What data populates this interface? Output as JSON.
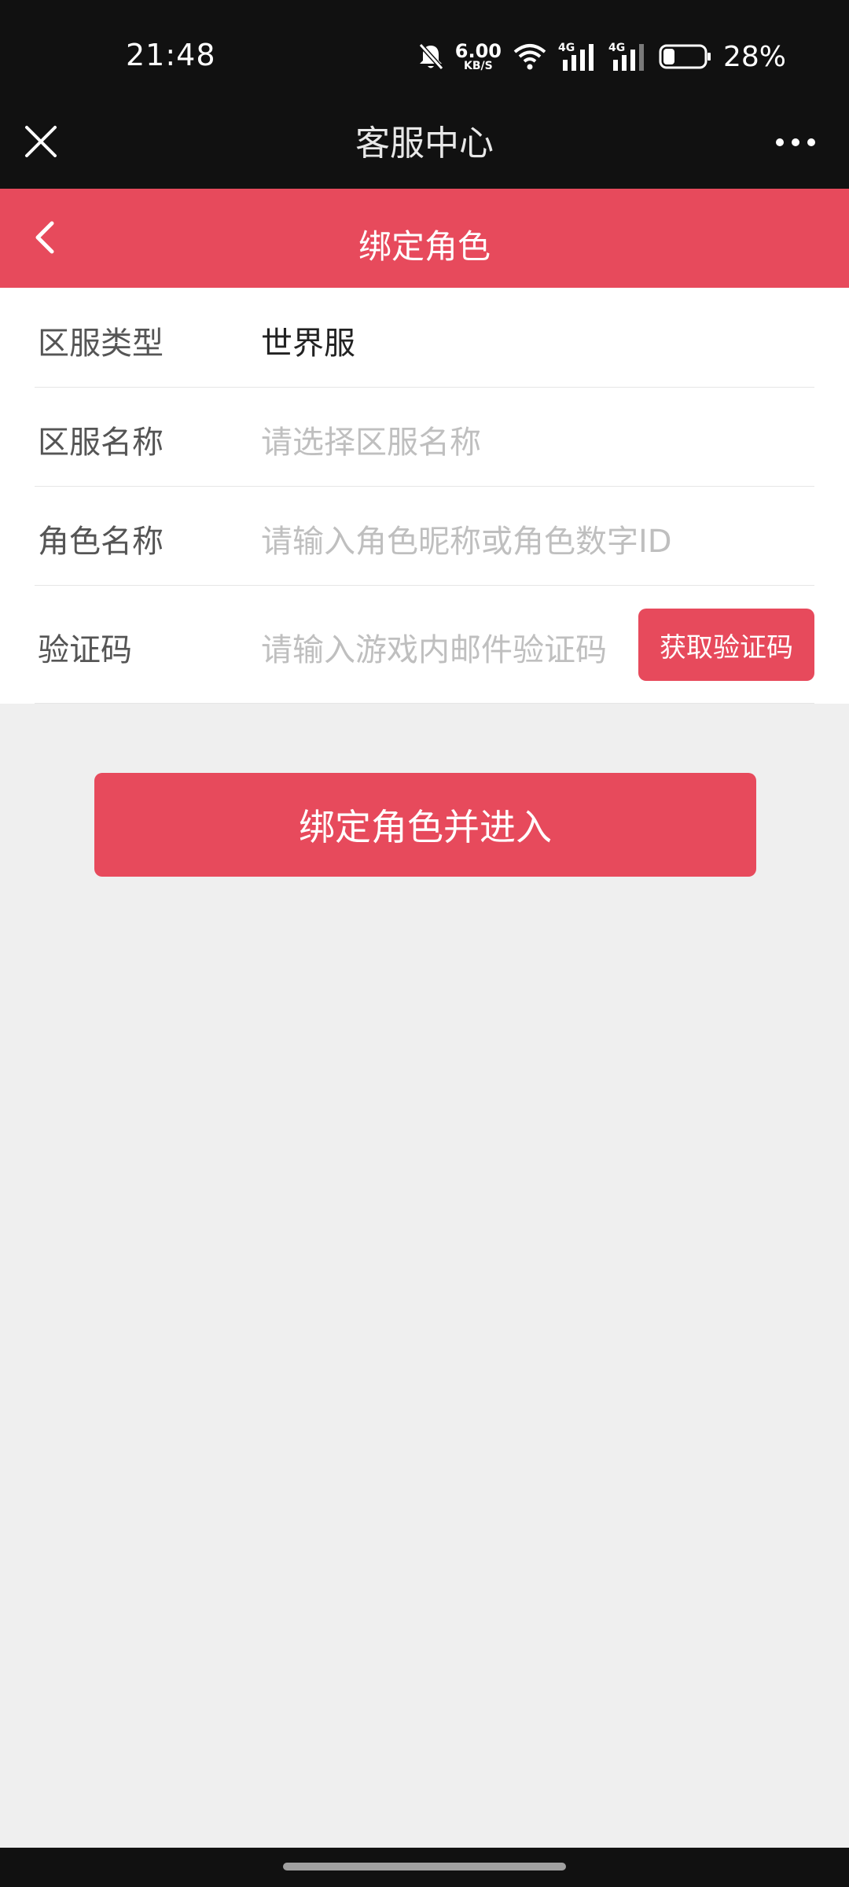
{
  "status_bar": {
    "time": "21:48",
    "net_speed_value": "6.00",
    "net_speed_unit": "KB/S",
    "network_1": "4G",
    "network_2": "4G",
    "battery_percent": "28%",
    "battery_level": 0.28,
    "icons": [
      "bell-muted-icon",
      "wifi-icon",
      "signal-icon",
      "signal-icon",
      "battery-icon"
    ]
  },
  "title_bar": {
    "title": "客服中心",
    "icons": [
      "close-icon",
      "more-icon"
    ]
  },
  "header": {
    "title": "绑定角色",
    "icons": [
      "back-icon"
    ]
  },
  "form": {
    "server_type": {
      "label": "区服类型",
      "value": "世界服"
    },
    "server_name": {
      "label": "区服名称",
      "placeholder": "请选择区服名称"
    },
    "role_name": {
      "label": "角色名称",
      "placeholder": "请输入角色昵称或角色数字ID"
    },
    "verification_code": {
      "label": "验证码",
      "placeholder": "请输入游戏内邮件验证码",
      "button_label": "获取验证码"
    }
  },
  "submit": {
    "label": "绑定角色并进入"
  },
  "colors": {
    "accent": "#e74a5c",
    "dark_bar": "#111111",
    "page_bg": "#efefef"
  }
}
